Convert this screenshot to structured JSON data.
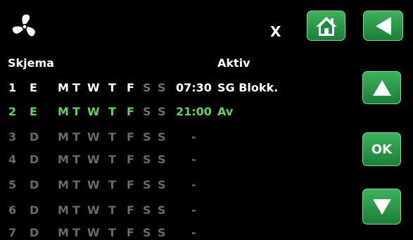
{
  "header": {
    "close_label": "X"
  },
  "buttons": {
    "ok_label": "OK"
  },
  "table": {
    "schedule_label": "Skjema",
    "active_label": "Aktiv"
  },
  "colors": {
    "active": "#ffffff",
    "enabled_off": "#6f6f6f",
    "current": "#5fd35a",
    "inactive": "#6a6a6a",
    "accent": "#2a9d48"
  },
  "rows": [
    {
      "num": "1",
      "mode": "E",
      "days": [
        "M",
        "T",
        "W",
        "T",
        "F",
        "S",
        "S"
      ],
      "days_on": [
        true,
        true,
        true,
        true,
        true,
        false,
        false
      ],
      "time": "07:30",
      "action": "SG Blokk.",
      "state": "active"
    },
    {
      "num": "2",
      "mode": "E",
      "days": [
        "M",
        "T",
        "W",
        "T",
        "F",
        "S",
        "S"
      ],
      "days_on": [
        true,
        true,
        true,
        true,
        true,
        false,
        false
      ],
      "time": "21:00",
      "action": "Av",
      "state": "current"
    },
    {
      "num": "3",
      "mode": "D",
      "days": [
        "M",
        "T",
        "W",
        "T",
        "F",
        "S",
        "S"
      ],
      "days_on": [
        false,
        false,
        false,
        false,
        false,
        false,
        false
      ],
      "time": "-",
      "action": "",
      "state": "inactive"
    },
    {
      "num": "4",
      "mode": "D",
      "days": [
        "M",
        "T",
        "W",
        "T",
        "F",
        "S",
        "S"
      ],
      "days_on": [
        false,
        false,
        false,
        false,
        false,
        false,
        false
      ],
      "time": "-",
      "action": "",
      "state": "inactive"
    },
    {
      "num": "5",
      "mode": "D",
      "days": [
        "M",
        "T",
        "W",
        "T",
        "F",
        "S",
        "S"
      ],
      "days_on": [
        false,
        false,
        false,
        false,
        false,
        false,
        false
      ],
      "time": "-",
      "action": "",
      "state": "inactive"
    },
    {
      "num": "6",
      "mode": "D",
      "days": [
        "M",
        "T",
        "W",
        "T",
        "F",
        "S",
        "S"
      ],
      "days_on": [
        false,
        false,
        false,
        false,
        false,
        false,
        false
      ],
      "time": "-",
      "action": "",
      "state": "inactive"
    },
    {
      "num": "7",
      "mode": "D",
      "days": [
        "M",
        "T",
        "W",
        "T",
        "F",
        "S",
        "S"
      ],
      "days_on": [
        false,
        false,
        false,
        false,
        false,
        false,
        false
      ],
      "time": "-",
      "action": "",
      "state": "inactive"
    }
  ]
}
